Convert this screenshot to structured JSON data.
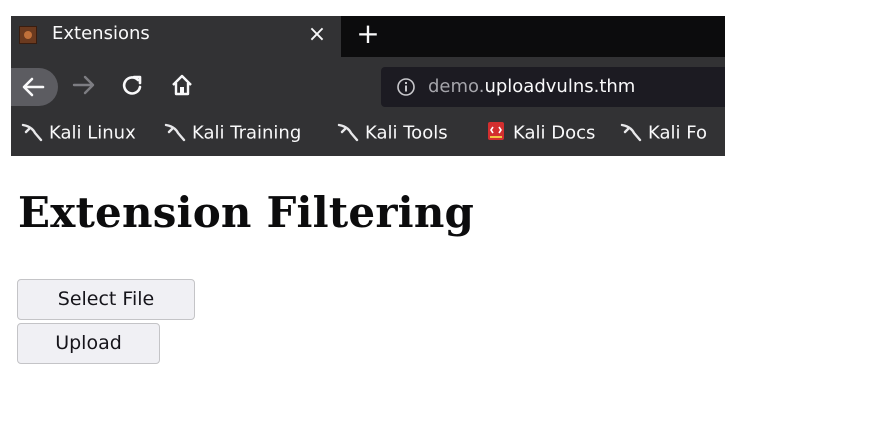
{
  "browser": {
    "tab": {
      "title": "Extensions",
      "close_glyph": "×"
    },
    "new_tab_glyph": "+",
    "url": {
      "subdomain": "demo.",
      "domain": "uploadvulns.thm"
    },
    "bookmarks": [
      {
        "label": "Kali Linux",
        "icon": "kali-dragon-icon"
      },
      {
        "label": "Kali Training",
        "icon": "kali-dragon-icon"
      },
      {
        "label": "Kali Tools",
        "icon": "kali-dragon-icon"
      },
      {
        "label": "Kali Docs",
        "icon": "kali-docs-icon"
      },
      {
        "label": "Kali Fo",
        "icon": "kali-dragon-icon"
      }
    ]
  },
  "page": {
    "title": "Extension Filtering",
    "select_button": "Select File",
    "upload_button": "Upload"
  },
  "colors": {
    "chrome_bg": "#323234",
    "tabbar_bg": "#0c0c0d",
    "urlbar_bg": "#1c1b22",
    "docs_icon": "#d32f2f"
  }
}
